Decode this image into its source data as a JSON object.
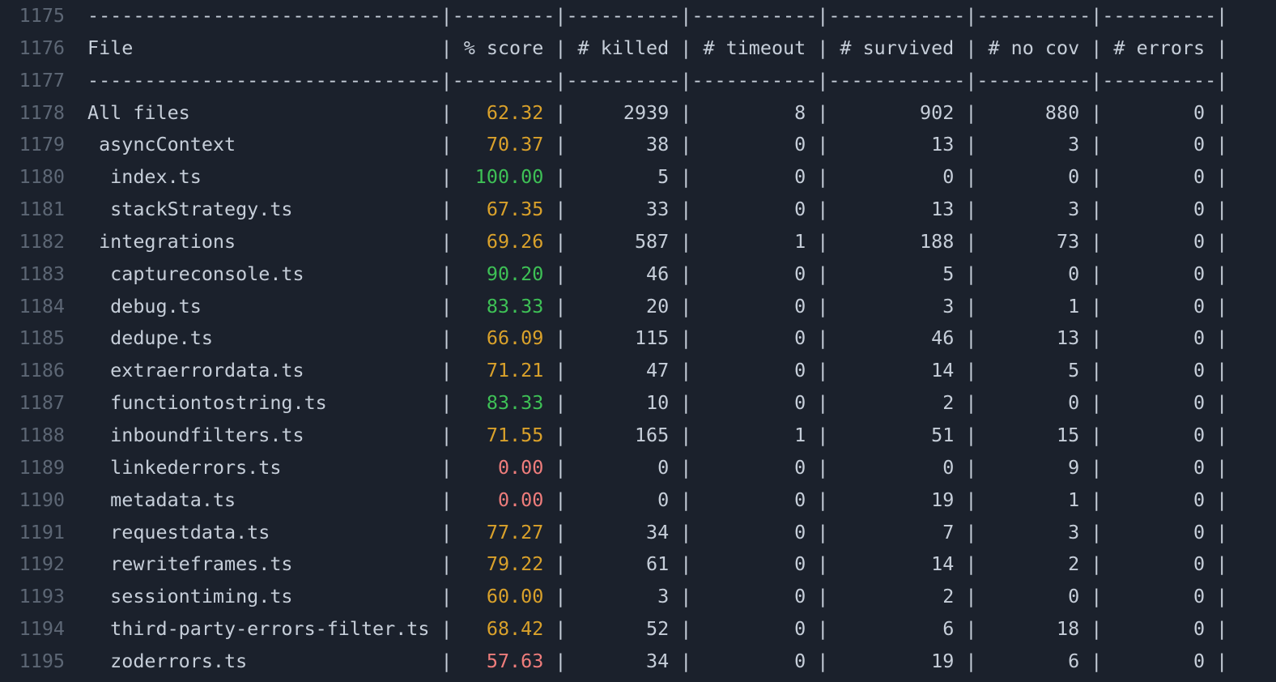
{
  "theme": {
    "background": "#1b212c",
    "text": "#c6ced9",
    "line_number": "#5d6775",
    "score_high": "#3ec156",
    "score_mid": "#d9a12b",
    "score_low": "#ef7d7c"
  },
  "editor": {
    "first_line_number": 1175,
    "table": {
      "columns": [
        {
          "key": "file",
          "label": "File",
          "width": 31
        },
        {
          "key": "score",
          "label": "% score",
          "width": 9
        },
        {
          "key": "killed",
          "label": "# killed",
          "width": 10
        },
        {
          "key": "timeout",
          "label": "# timeout",
          "width": 11
        },
        {
          "key": "survived",
          "label": "# survived",
          "width": 12
        },
        {
          "key": "nocov",
          "label": "# no cov",
          "width": 10
        },
        {
          "key": "errors",
          "label": "# errors",
          "width": 10
        }
      ],
      "rows": [
        {
          "file": "All files",
          "indent": 0,
          "score": "62.32",
          "level": "mid",
          "killed": "2939",
          "timeout": "8",
          "survived": "902",
          "nocov": "880",
          "errors": "0"
        },
        {
          "file": "asyncContext",
          "indent": 1,
          "score": "70.37",
          "level": "mid",
          "killed": "38",
          "timeout": "0",
          "survived": "13",
          "nocov": "3",
          "errors": "0"
        },
        {
          "file": "index.ts",
          "indent": 2,
          "score": "100.00",
          "level": "high",
          "killed": "5",
          "timeout": "0",
          "survived": "0",
          "nocov": "0",
          "errors": "0"
        },
        {
          "file": "stackStrategy.ts",
          "indent": 2,
          "score": "67.35",
          "level": "mid",
          "killed": "33",
          "timeout": "0",
          "survived": "13",
          "nocov": "3",
          "errors": "0"
        },
        {
          "file": "integrations",
          "indent": 1,
          "score": "69.26",
          "level": "mid",
          "killed": "587",
          "timeout": "1",
          "survived": "188",
          "nocov": "73",
          "errors": "0"
        },
        {
          "file": "captureconsole.ts",
          "indent": 2,
          "score": "90.20",
          "level": "high",
          "killed": "46",
          "timeout": "0",
          "survived": "5",
          "nocov": "0",
          "errors": "0"
        },
        {
          "file": "debug.ts",
          "indent": 2,
          "score": "83.33",
          "level": "high",
          "killed": "20",
          "timeout": "0",
          "survived": "3",
          "nocov": "1",
          "errors": "0"
        },
        {
          "file": "dedupe.ts",
          "indent": 2,
          "score": "66.09",
          "level": "mid",
          "killed": "115",
          "timeout": "0",
          "survived": "46",
          "nocov": "13",
          "errors": "0"
        },
        {
          "file": "extraerrordata.ts",
          "indent": 2,
          "score": "71.21",
          "level": "mid",
          "killed": "47",
          "timeout": "0",
          "survived": "14",
          "nocov": "5",
          "errors": "0"
        },
        {
          "file": "functiontostring.ts",
          "indent": 2,
          "score": "83.33",
          "level": "high",
          "killed": "10",
          "timeout": "0",
          "survived": "2",
          "nocov": "0",
          "errors": "0"
        },
        {
          "file": "inboundfilters.ts",
          "indent": 2,
          "score": "71.55",
          "level": "mid",
          "killed": "165",
          "timeout": "1",
          "survived": "51",
          "nocov": "15",
          "errors": "0"
        },
        {
          "file": "linkederrors.ts",
          "indent": 2,
          "score": "0.00",
          "level": "low",
          "killed": "0",
          "timeout": "0",
          "survived": "0",
          "nocov": "9",
          "errors": "0"
        },
        {
          "file": "metadata.ts",
          "indent": 2,
          "score": "0.00",
          "level": "low",
          "killed": "0",
          "timeout": "0",
          "survived": "19",
          "nocov": "1",
          "errors": "0"
        },
        {
          "file": "requestdata.ts",
          "indent": 2,
          "score": "77.27",
          "level": "mid",
          "killed": "34",
          "timeout": "0",
          "survived": "7",
          "nocov": "3",
          "errors": "0"
        },
        {
          "file": "rewriteframes.ts",
          "indent": 2,
          "score": "79.22",
          "level": "mid",
          "killed": "61",
          "timeout": "0",
          "survived": "14",
          "nocov": "2",
          "errors": "0"
        },
        {
          "file": "sessiontiming.ts",
          "indent": 2,
          "score": "60.00",
          "level": "mid",
          "killed": "3",
          "timeout": "0",
          "survived": "2",
          "nocov": "0",
          "errors": "0"
        },
        {
          "file": "third-party-errors-filter.ts",
          "indent": 2,
          "score": "68.42",
          "level": "mid",
          "killed": "52",
          "timeout": "0",
          "survived": "6",
          "nocov": "18",
          "errors": "0"
        },
        {
          "file": "zoderrors.ts",
          "indent": 2,
          "score": "57.63",
          "level": "low",
          "killed": "34",
          "timeout": "0",
          "survived": "19",
          "nocov": "6",
          "errors": "0"
        }
      ]
    }
  }
}
